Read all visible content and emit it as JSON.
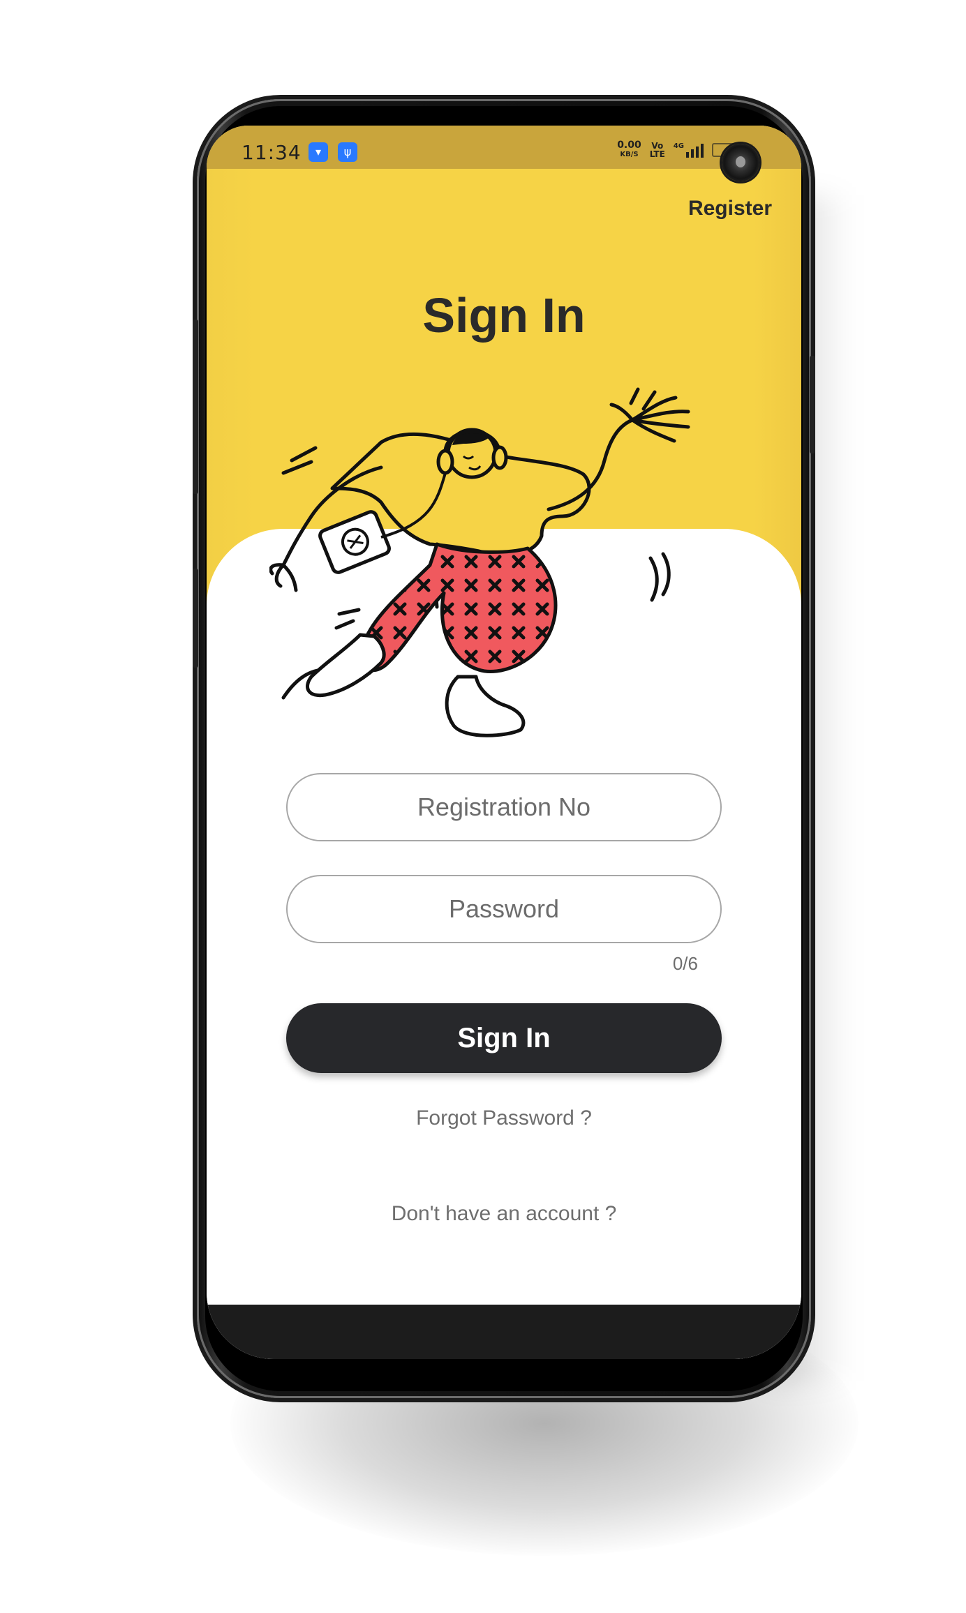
{
  "status_bar": {
    "time": "11:34",
    "net_speed_value": "0.00",
    "net_speed_unit": "KB/S",
    "volte_top": "Vo",
    "volte_bottom": "LTE",
    "network": "4G",
    "app_icons": [
      "android-icon",
      "usb-icon"
    ]
  },
  "header": {
    "register_label": "Register",
    "title": "Sign In"
  },
  "form": {
    "registration_placeholder": "Registration No",
    "password_placeholder": "Password",
    "password_counter": "0/6",
    "submit_label": "Sign In"
  },
  "links": {
    "forgot_password": "Forgot Password ?",
    "no_account": "Don't have an account ?"
  },
  "colors": {
    "header_yellow": "#f6d346",
    "status_bar": "#c9a53c",
    "button_dark": "#27282b",
    "pants_red": "#f0595e"
  }
}
